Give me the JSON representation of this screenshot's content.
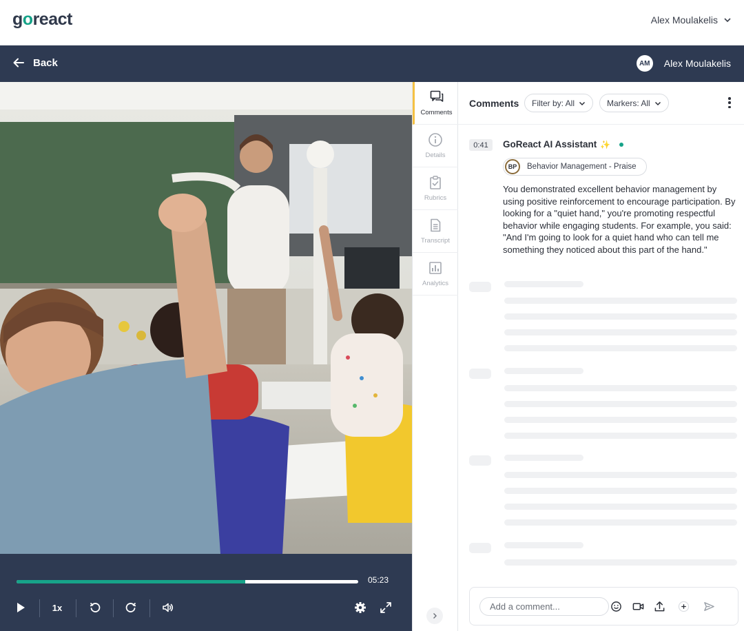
{
  "app": {
    "logo": {
      "pre": "g",
      "accent": "o",
      "post": "react"
    },
    "user_name": "Alex Moulakelis"
  },
  "nav": {
    "back_label": "Back",
    "avatar_initials": "AM",
    "user_name": "Alex Moulakelis"
  },
  "player": {
    "duration": "05:23",
    "progress_percent": 67,
    "speed": "1x"
  },
  "side_tabs": [
    {
      "label": "Comments",
      "icon": "comments-icon",
      "active": true
    },
    {
      "label": "Details",
      "icon": "info-icon",
      "active": false
    },
    {
      "label": "Rubrics",
      "icon": "rubric-clipboard-icon",
      "active": false
    },
    {
      "label": "Transcript",
      "icon": "transcript-document-icon",
      "active": false
    },
    {
      "label": "Analytics",
      "icon": "analytics-chart-icon",
      "active": false
    }
  ],
  "comments_panel": {
    "title": "Comments",
    "filter_label": "Filter by: All",
    "markers_label": "Markers: All",
    "comment": {
      "timestamp": "0:41",
      "author": "GoReact AI Assistant",
      "marker_abbr": "BP",
      "marker_label": "Behavior Management - Praise",
      "body": "You demonstrated excellent behavior management by using positive reinforcement to encourage participation. By looking for a \"quiet hand,\" you're promoting respectful behavior while engaging students. For example, you said: \"And I'm going to look for a quiet hand who can tell me something they noticed about this part of the hand.\""
    },
    "composer_placeholder": "Add a comment..."
  },
  "colors": {
    "brand_teal": "#17a389",
    "navy": "#2e3a52",
    "active_tab_accent": "#f5c144"
  }
}
